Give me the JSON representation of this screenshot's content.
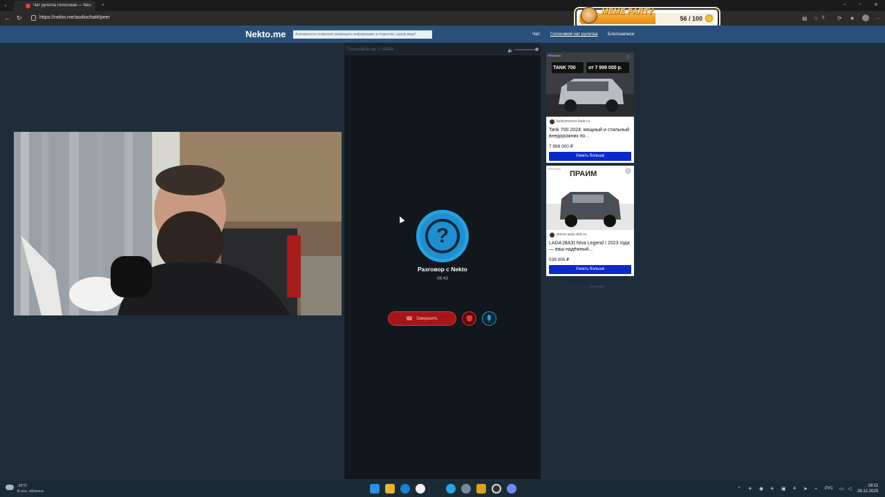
{
  "browser": {
    "tab_title": "Чат рулетка голосовая — Ne",
    "url": "https://nekto.me/audiochat#/peer",
    "extension_count": "8"
  },
  "meme_party": {
    "title": "MEME PARTY",
    "progress_text": "56 / 100",
    "progress_fraction": 0.56
  },
  "site": {
    "logo": "Nekto.me",
    "slogan": "Анонимность позволяет размещать информацию в открытом, сыром виде!",
    "nav": [
      "Чат",
      "Голосовой чат рулетка",
      "Блогозаписи"
    ],
    "active_nav_index": 1
  },
  "chat": {
    "header_label": "Голосовой чат с Nekto",
    "avatar_symbol": "?",
    "conversation_title": "Разговор с Nekto",
    "timer": "06:43",
    "end_button_label": "Завершить"
  },
  "ads": [
    {
      "badge": "РЕКЛАМА",
      "image_text_model": "TANK 700",
      "image_text_price": "от 7 999 000 р.",
      "domain": "luckymotors-tank.ru",
      "title": "Tank 700 2024: мощный и стильный внедорожник по...",
      "price": "7 999 000 ₽",
      "cta": "Узнать больше"
    },
    {
      "badge": "РЕКЛАМА",
      "image_text_brand": "ПРАИМ",
      "domain": "prime-auto-ekb.ru",
      "title": "LADA (ВАЗ) Niva Legend I 2023 года — ваш надёжный...",
      "price": "539 000 ₽",
      "cta": "Узнать больше"
    }
  ],
  "footer": {
    "copyright": "© 2013-2025",
    "link": "NektoMe"
  },
  "taskbar": {
    "temperature": "-21°C",
    "weather": "В осн. облачно",
    "language": "РУС",
    "time": "18:11",
    "date": "26.12.2025"
  },
  "colors": {
    "accent_blue": "#1f8fcf",
    "end_call_red": "#a51616",
    "header_blue": "#2a5079",
    "ad_cta_blue": "#0a2ac9"
  }
}
